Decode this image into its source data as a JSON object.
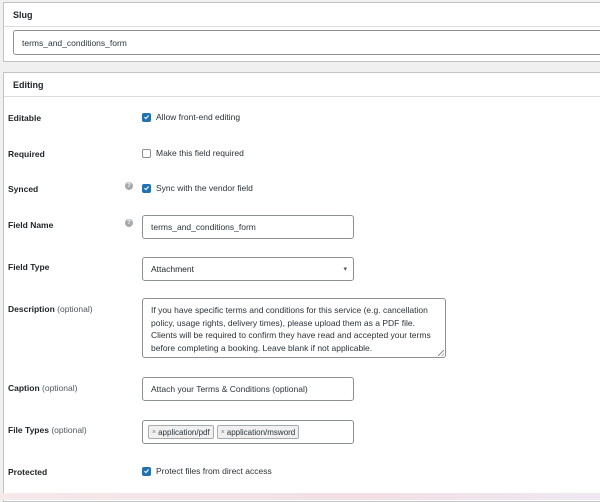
{
  "slug": {
    "heading": "Slug",
    "value": "terms_and_conditions_form"
  },
  "editing": {
    "heading": "Editing",
    "editable": {
      "label": "Editable",
      "checkbox_label": "Allow front-end editing",
      "checked": true
    },
    "required": {
      "label": "Required",
      "checkbox_label": "Make this field required",
      "checked": false
    },
    "synced": {
      "label": "Synced",
      "checkbox_label": "Sync with the vendor field",
      "checked": true,
      "help_icon": "question-circle-icon"
    },
    "field_name": {
      "label": "Field Name",
      "value": "terms_and_conditions_form",
      "help_icon": "question-circle-icon"
    },
    "field_type": {
      "label": "Field Type",
      "selected": "Attachment",
      "icon": "chevron-down-icon"
    },
    "description": {
      "label": "Description",
      "optional": "(optional)",
      "value": "If you have specific terms and conditions for this service (e.g. cancellation policy, usage rights, delivery times), please upload them as a PDF file. Clients will be required to confirm they have read and accepted your terms before completing a booking. Leave blank if not applicable."
    },
    "caption": {
      "label": "Caption",
      "optional": "(optional)",
      "value": "Attach your Terms & Conditions (optional)"
    },
    "file_types": {
      "label": "File Types",
      "optional": "(optional)",
      "remove_symbol": "×",
      "tags": [
        "application/pdf",
        "application/msword"
      ]
    },
    "protected": {
      "label": "Protected",
      "checkbox_label": "Protect files from direct access",
      "checked": true
    }
  },
  "colors": {
    "accent": "#2271b1",
    "border": "#8c8f94",
    "background": "#f0f0f1"
  }
}
